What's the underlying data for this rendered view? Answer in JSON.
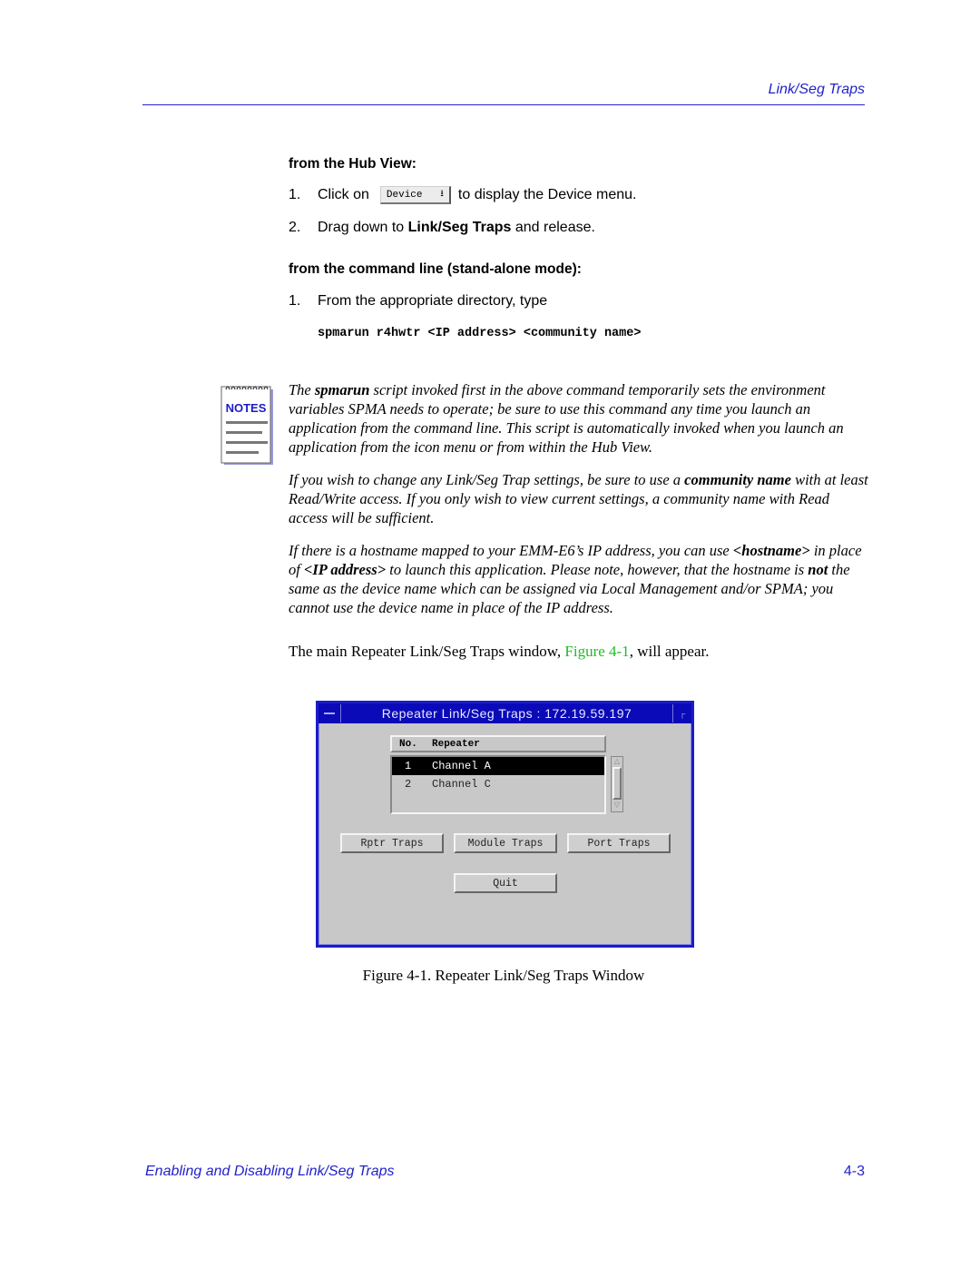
{
  "header": {
    "running_title": "Link/Seg Traps"
  },
  "section_hub_view": {
    "heading": "from the Hub View:",
    "steps": [
      {
        "num": "1.",
        "before": "Click on",
        "button_label": "Device",
        "button_icon": "dropdown-arrow-icon",
        "after": "to display the Device menu."
      },
      {
        "num": "2.",
        "before": "Drag down to ",
        "bold": "Link/Seg Traps",
        "after": " and release."
      }
    ]
  },
  "section_command_line": {
    "heading": "from the command line (stand-alone mode):",
    "steps": [
      {
        "num": "1.",
        "text": "From the appropriate directory, type"
      }
    ],
    "command": "spmarun r4hwtr <IP address> <community name>"
  },
  "notes": {
    "icon_label": "NOTES",
    "paragraph1": {
      "pre": "The ",
      "bold": "spmarun",
      "post": " script invoked first in the above command temporarily sets the environment variables SPMA needs to operate; be sure to use this command any time you launch an application from the command line. This script is automatically invoked when you launch an application from the icon menu or from within the Hub View."
    },
    "paragraph2": {
      "pre": "If you wish to change any Link/Seg Trap settings, be sure to use a ",
      "bold": "community name",
      "post": " with at least Read/Write access. If you only wish to view current settings, a community name with Read access will be sufficient."
    },
    "paragraph3": {
      "pre": "If there is a hostname mapped to your EMM-E6’s IP address, you can use ",
      "bold1": "<hostname>",
      "mid1": " in place of ",
      "bold2": "<IP address>",
      "mid2": " to launch this application. Please note, however, that the hostname is ",
      "bold3": "not",
      "post": " the same as the device name which can be assigned via Local Management and/or SPMA; you cannot use the device name in place of the IP address."
    }
  },
  "intro_sentence": {
    "pre": "The main Repeater Link/Seg Traps window, ",
    "link": "Figure 4-1",
    "post": ", will appear."
  },
  "window": {
    "title": "Repeater Link/Seg Traps : 172.19.59.197",
    "list_headers": {
      "no": "No.",
      "repeater": "Repeater"
    },
    "rows": [
      {
        "no": "1",
        "name": "Channel A",
        "selected": true
      },
      {
        "no": "2",
        "name": "Channel C",
        "selected": false
      }
    ],
    "buttons": {
      "rptr": "Rptr Traps",
      "module": "Module Traps",
      "port": "Port Traps",
      "quit": "Quit"
    }
  },
  "caption": "Figure 4-1.  Repeater Link/Seg Traps Window",
  "footer": {
    "section": "Enabling and Disabling Link/Seg Traps",
    "page": "4-3"
  },
  "colors": {
    "accent_blue": "#2222cc",
    "link_green": "#22bb22",
    "window_title_bg": "#0a0ab8"
  }
}
